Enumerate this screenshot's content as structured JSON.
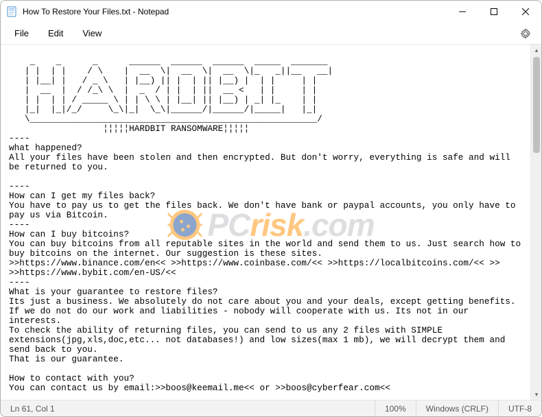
{
  "window": {
    "title": "How To Restore Your Files.txt - Notepad"
  },
  "menubar": {
    "file": "File",
    "edit": "Edit",
    "view": "View"
  },
  "document": {
    "lines": [
      "",
      "    _    _      _      ______  ______  ______  _____  _______",
      "   | |  | |    / \\    |  __  \\|  __  \\|  __  \\|_   _||__   __|",
      "   | |__| |   / _ \\   | |__) || |  | || |__) |  | |     | |",
      "   |  __  |  / /_\\ \\  |  _  / | |  | ||  __ <   | |     | |",
      "   | |  | | / _____ \\ | | \\ \\ | |__| || |__) | _| |_    | |",
      "   |_|  |_|/_/     \\_\\|_|  \\_\\|______/|______/|_____|   |_|",
      "   \\_______________________________________________________/",
      "                  ¦¦¦¦¦HARDBIT RANSOMWARE¦¦¦¦¦",
      "----",
      "what happened?",
      "All your files have been stolen and then encrypted. But don't worry, everything is safe and will be returned to you.",
      "",
      "----",
      "How can I get my files back?",
      "You have to pay us to get the files back. We don't have bank or paypal accounts, you only have to pay us via Bitcoin.",
      "----",
      "How can I buy bitcoins?",
      "You can buy bitcoins from all reputable sites in the world and send them to us. Just search how to buy bitcoins on the internet. Our suggestion is these sites.",
      ">>https://www.binance.com/en<< >>https://www.coinbase.com/<< >>https://localbitcoins.com/<< >>",
      ">>https://www.bybit.com/en-US/<<",
      "----",
      "What is your guarantee to restore files?",
      "Its just a business. We absolutely do not care about you and your deals, except getting benefits. If we do not do our work and liabilities - nobody will cooperate with us. Its not in our interests.",
      "To check the ability of returning files, you can send to us any 2 files with SIMPLE extensions(jpg,xls,doc,etc... not databases!) and low sizes(max 1 mb), we will decrypt them and send back to you.",
      "That is our guarantee.",
      "",
      "How to contact with you?",
      "You can contact us by email:>>boos@keemail.me<< or >>boos@cyberfear.com<<"
    ]
  },
  "statusbar": {
    "position": "Ln 61, Col 1",
    "zoom": "100%",
    "line_ending": "Windows (CRLF)",
    "encoding": "UTF-8"
  },
  "watermark": {
    "part_a": "PC",
    "part_b": "risk",
    "suffix": ".com"
  }
}
